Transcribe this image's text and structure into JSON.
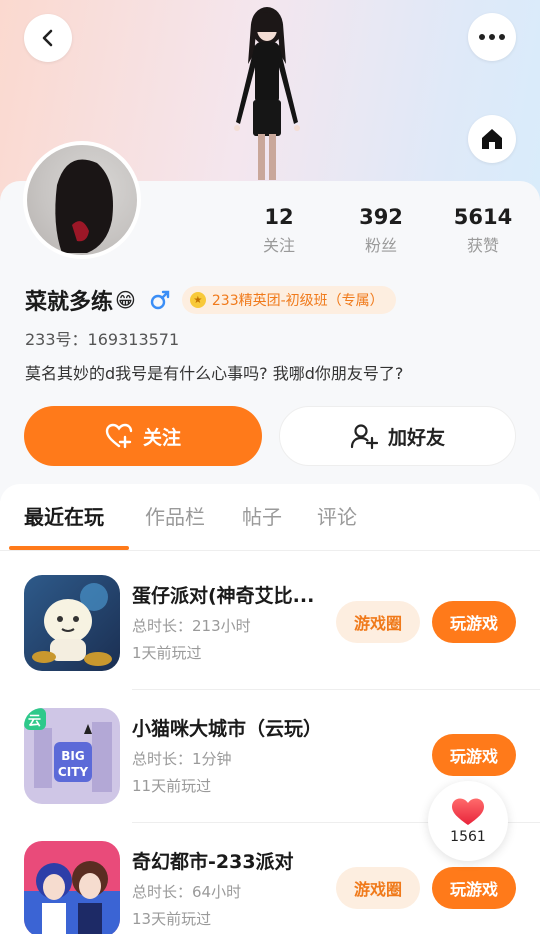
{
  "profile": {
    "name": "菜就多练",
    "name_emoji": "😁",
    "gender_icon": "male-icon",
    "badge": "233精英团-初级班（专属）",
    "uid": "233号：169313571",
    "bio": "莫名其妙的d我号是有什么心事吗? 我哪d你朋友号了?"
  },
  "stats": [
    {
      "value": "12",
      "label": "关注"
    },
    {
      "value": "392",
      "label": "粉丝"
    },
    {
      "value": "5614",
      "label": "获赞"
    }
  ],
  "actions": {
    "follow_label": "关注",
    "add_friend_label": "加好友"
  },
  "tabs": [
    {
      "label": "最近在玩"
    },
    {
      "label": "作品栏"
    },
    {
      "label": "帖子"
    },
    {
      "label": "评论"
    }
  ],
  "games": [
    {
      "title": "蛋仔派对(神奇艾比...",
      "duration": "总时长：213小时",
      "last_played": "1天前玩过",
      "circle_label": "游戏圈",
      "play_label": "玩游戏"
    },
    {
      "title": "小猫咪大城市（云玩）",
      "duration": "总时长：1分钟",
      "last_played": "11天前玩过",
      "cloud_tag": "云",
      "play_label": "玩游戏"
    },
    {
      "title": "奇幻都市-233派对",
      "duration": "总时长：64小时",
      "last_played": "13天前玩过",
      "circle_label": "游戏圈",
      "play_label": "玩游戏"
    }
  ],
  "like": {
    "count": "1561"
  },
  "colors": {
    "accent": "#ff7a1a",
    "accent_soft": "#fdeee0",
    "gender_blue": "#3a8ef6"
  },
  "icons": {
    "back": "back-chevron-icon",
    "more": "more-dots-icon",
    "home": "home-icon",
    "follow": "heart-plus-icon",
    "add_friend": "user-plus-icon",
    "like": "heart-icon"
  }
}
